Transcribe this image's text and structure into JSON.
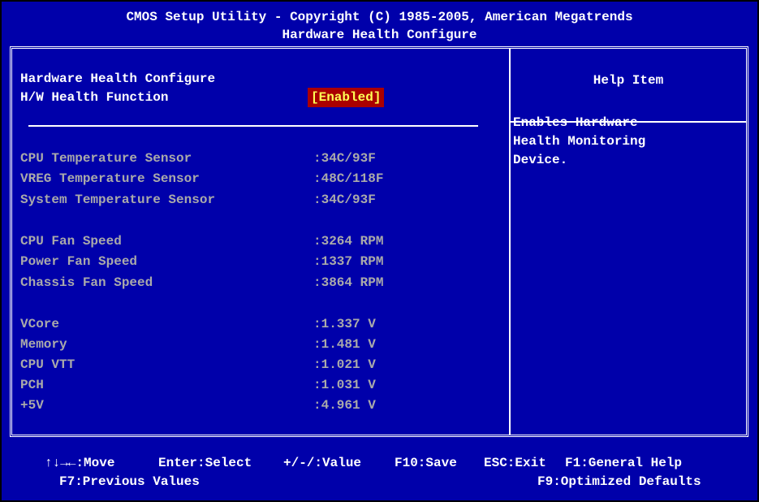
{
  "header": {
    "line1": "CMOS Setup Utility - Copyright (C) 1985-2005, American Megatrends",
    "line2": "Hardware Health Configure"
  },
  "main": {
    "section_title": "Hardware Health Configure",
    "hw_health": {
      "label": "H/W Health Function",
      "value": "[Enabled]"
    },
    "temperatures": [
      {
        "label": "CPU Temperature Sensor",
        "value": ":34C/93F"
      },
      {
        "label": "VREG Temperature Sensor",
        "value": ":48C/118F"
      },
      {
        "label": "System Temperature Sensor",
        "value": ":34C/93F"
      }
    ],
    "fans": [
      {
        "label": "CPU Fan Speed",
        "value": ":3264 RPM"
      },
      {
        "label": "Power Fan Speed",
        "value": ":1337 RPM"
      },
      {
        "label": "Chassis Fan Speed",
        "value": ":3864 RPM"
      }
    ],
    "voltages": [
      {
        "label": "VCore",
        "value": ":1.337 V"
      },
      {
        "label": "Memory",
        "value": ":1.481 V"
      },
      {
        "label": "CPU VTT",
        "value": ":1.021 V"
      },
      {
        "label": "PCH",
        "value": ":1.031 V"
      },
      {
        "label": "+5V",
        "value": ":4.961 V"
      }
    ]
  },
  "help": {
    "title": "Help Item",
    "lines": [
      "Enables Hardware",
      "Health Monitoring",
      "Device."
    ]
  },
  "footer": {
    "move": "↑↓→←:Move",
    "select": "Enter:Select",
    "value": "+/-/:Value",
    "save": "F10:Save",
    "exit": "ESC:Exit",
    "general_help": "F1:General Help",
    "previous": "F7:Previous Values",
    "optimized": "F9:Optimized Defaults"
  },
  "colors": {
    "background": "#0000aa",
    "text_primary": "#ffffff",
    "text_dim": "#aaaaaa",
    "highlight_bg": "#aa0000",
    "highlight_text": "#ffff55"
  }
}
